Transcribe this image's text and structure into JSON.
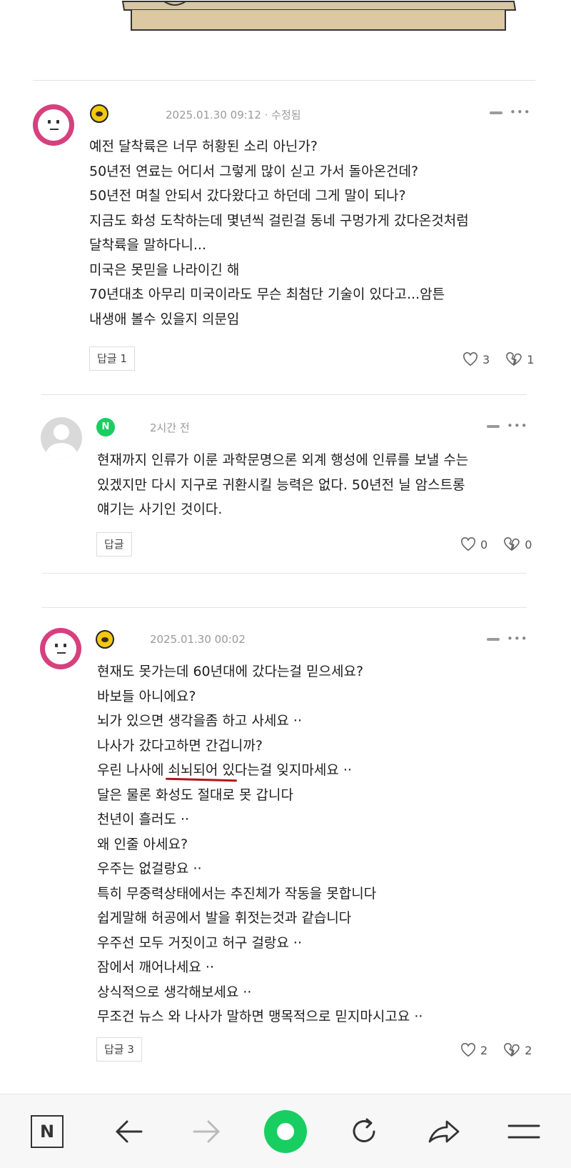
{
  "comments": [
    {
      "badge": "kakao",
      "timestamp": "2025.01.30 09:12 · 수정됨",
      "lines": [
        "예전 달착륙은 너무 허황된 소리 아닌가?",
        "50년전 연료는 어디서 그렇게 많이 싣고 가서 돌아온건데?",
        "50년전 며칠 안되서 갔다왔다고 하던데 그게 말이 되나?",
        "지금도 화성 도착하는데 몇년씩 걸린걸 동네 구멍가게 갔다온것처럼",
        "달착륙을 말하다니...",
        "미국은 못믿을 나라이긴 해",
        "70년대초 아무리 미국이라도 무슨 최첨단 기술이 있다고...암튼",
        "내생애 볼수 있을지 의문임"
      ],
      "reply_label": "답글 1",
      "likes": "3",
      "dislikes": "1"
    },
    {
      "badge": "naver",
      "badge_letter": "N",
      "timestamp": "2시간 전",
      "lines": [
        "현재까지 인류가 이룬 과학문명으론 외계 행성에 인류를 보낼 수는",
        "있겠지만 다시 지구로 귀환시킬 능력은 없다. 50년전 닐 암스트롱",
        "얘기는 사기인 것이다."
      ],
      "reply_label": "답글",
      "likes": "0",
      "dislikes": "0"
    },
    {
      "badge": "kakao",
      "timestamp": "2025.01.30 00:02",
      "lines": [
        "현재도 못가는데 60년대에 갔다는걸 믿으세요?",
        "바보들 아니에요?",
        "뇌가 있으면 생각을좀 하고 사세요 ··",
        "나사가 갔다고하면 간겁니까?",
        "우린 나사에 쇠뇌되어 있다는걸 잊지마세요 ··",
        "달은 물론 화성도 절대로 못 갑니다",
        "천년이 흘러도 ··",
        "왜 인줄 아세요?",
        "우주는 없걸랑요 ··",
        "특히 무중력상태에서는 추진체가 작동을 못합니다",
        "쉽게말해 허공에서 발을 휘젓는것과 같습니다",
        "우주선 모두 거짓이고 허구 걸랑요 ··",
        "잠에서 깨어나세요 ··",
        "상식적으로 생각해보세요 ··",
        "무조건 뉴스 와 나사가 말하면 맹목적으로 믿지마시고요 ··"
      ],
      "reply_label": "답글 3",
      "likes": "2",
      "dislikes": "2"
    }
  ],
  "toolbar": {
    "home_letter": "N"
  },
  "colors": {
    "avatar_pink": "#d6407e",
    "naver_green": "#19ce60",
    "kakao_yellow": "#f2c811",
    "underline_red": "#b0171c"
  },
  "icons": [
    "heart-icon",
    "broken-heart-icon",
    "more-icon",
    "back-arrow-icon",
    "forward-arrow-icon",
    "refresh-icon",
    "share-icon",
    "menu-icon",
    "naver-home-icon",
    "green-circle-button"
  ]
}
